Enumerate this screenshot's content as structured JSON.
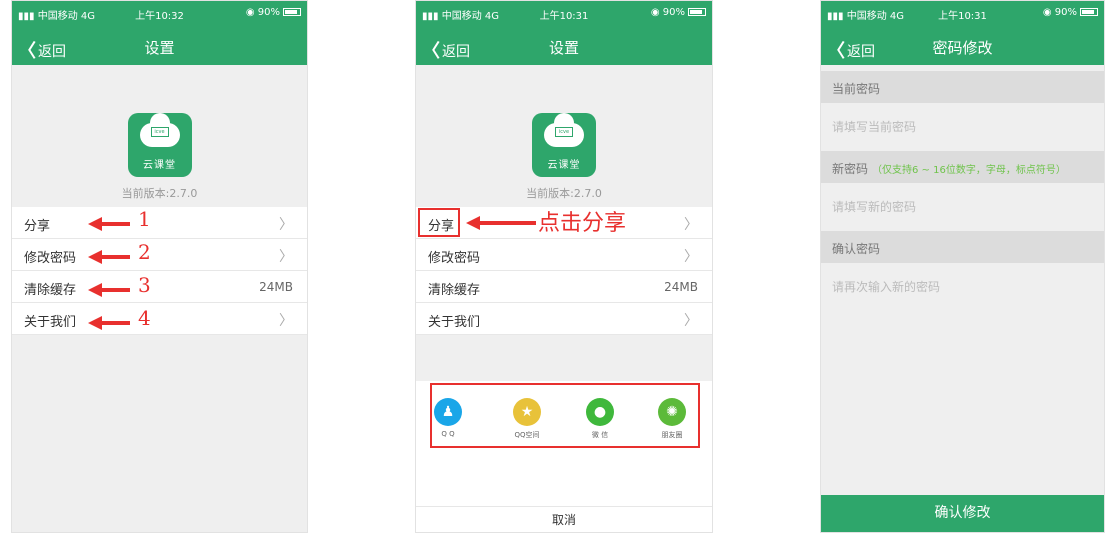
{
  "status": [
    {
      "carrier": "中国移动",
      "network": "4G",
      "time": "上午10:32",
      "battery": "90%"
    },
    {
      "carrier": "中国移动",
      "network": "4G",
      "time": "上午10:31",
      "battery": "90%"
    },
    {
      "carrier": "中国移动",
      "network": "4G",
      "time": "上午10:31",
      "battery": "90%"
    }
  ],
  "back_label": "返回",
  "settings": {
    "title": "设置",
    "app_icon_text": "icve",
    "app_name": "云课堂",
    "version": "当前版本:2.7.0",
    "menu": [
      {
        "label": "分享",
        "value": ""
      },
      {
        "label": "修改密码",
        "value": ""
      },
      {
        "label": "清除缓存",
        "value": "24MB"
      },
      {
        "label": "关于我们",
        "value": ""
      }
    ]
  },
  "annotations": {
    "numbers": [
      "1",
      "2",
      "3",
      "4"
    ],
    "click_share": "点击分享"
  },
  "share": {
    "items": [
      {
        "label": "Q Q",
        "icon": "qq-icon",
        "color": "#1aa6e8"
      },
      {
        "label": "QQ空间",
        "icon": "qzone-icon",
        "color": "#e8c23a"
      },
      {
        "label": "微 信",
        "icon": "wechat-icon",
        "color": "#3fb83c"
      },
      {
        "label": "朋友圈",
        "icon": "moments-icon",
        "color": "#5cba3a"
      }
    ],
    "cancel": "取消"
  },
  "password": {
    "title": "密码修改",
    "current_label": "当前密码",
    "current_placeholder": "请填写当前密码",
    "new_label": "新密码",
    "new_hint": "（仅支持6 ~ 16位数字，字母，标点符号）",
    "new_placeholder": "请填写新的密码",
    "confirm_label": "确认密码",
    "confirm_placeholder": "请再次输入新的密码",
    "submit": "确认修改"
  },
  "colors": {
    "brand": "#2ea66b",
    "annotation": "#e8302e"
  }
}
